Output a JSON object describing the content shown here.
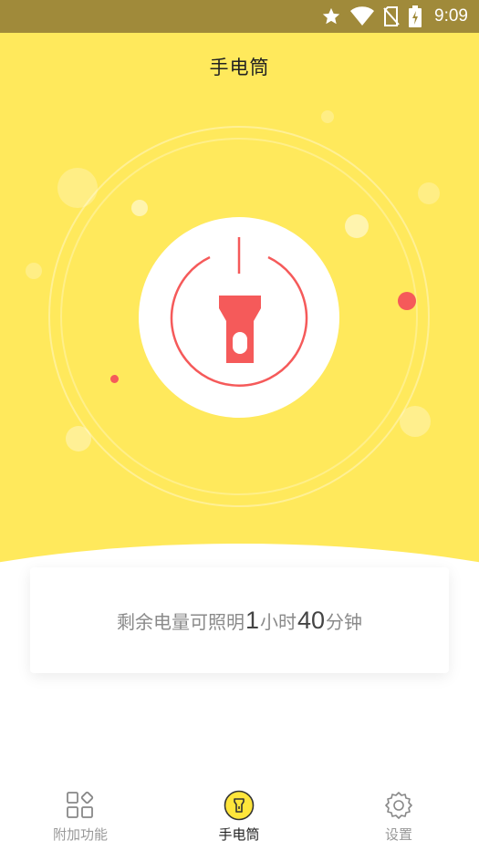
{
  "status_bar": {
    "time": "9:09"
  },
  "header": {
    "title": "手电筒"
  },
  "card": {
    "prefix": "剩余电量可照明",
    "hours": "1",
    "hours_unit": "小时",
    "minutes": "40",
    "minutes_unit": "分钟"
  },
  "tabs": [
    {
      "label": "附加功能",
      "icon": "grid-icon",
      "active": false
    },
    {
      "label": "手电筒",
      "icon": "flashlight-icon",
      "active": true
    },
    {
      "label": "设置",
      "icon": "gear-icon",
      "active": false
    }
  ],
  "colors": {
    "status_bar": "#a08a3a",
    "hero_background": "#ffe95c",
    "accent_red": "#f55a5a",
    "active_tab_fill": "#ffe53b"
  }
}
